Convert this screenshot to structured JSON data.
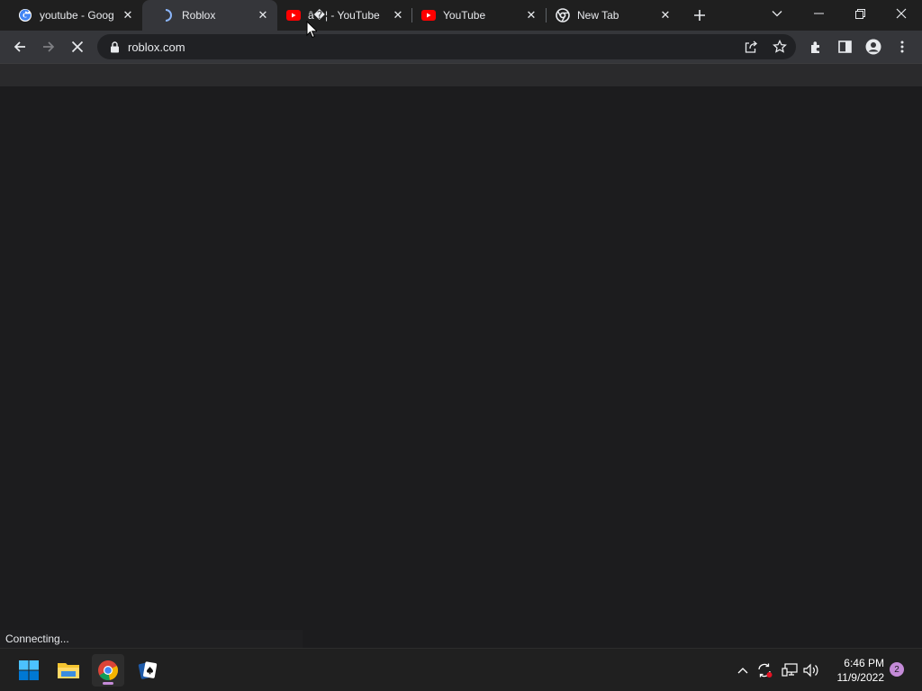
{
  "tabs": [
    {
      "title": "youtube - Google",
      "icon": "google-icon",
      "active": false
    },
    {
      "title": "Roblox",
      "icon": "loading-spinner-icon",
      "active": true
    },
    {
      "title": "â�¦ - YouTube",
      "icon": "youtube-icon",
      "active": false
    },
    {
      "title": "YouTube",
      "icon": "youtube-icon",
      "active": false
    },
    {
      "title": "New Tab",
      "icon": "chrome-icon",
      "active": false
    }
  ],
  "omnibox": {
    "url": "roblox.com"
  },
  "status": {
    "text": "Connecting..."
  },
  "clock": {
    "time": "6:46 PM",
    "date": "11/9/2022"
  },
  "notifications": {
    "count": "2"
  },
  "colors": {
    "youtube_red": "#ff0000",
    "tray_badge": "#c48bd8",
    "chrome_dark": "#35363a"
  }
}
